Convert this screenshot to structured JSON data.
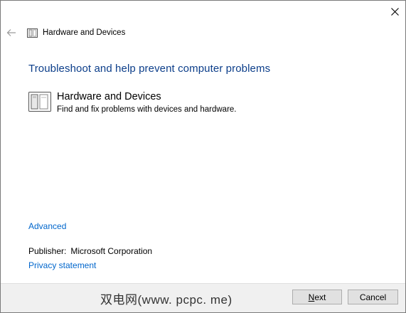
{
  "window": {
    "title": "Hardware and Devices"
  },
  "header": {
    "heading": "Troubleshoot and help prevent computer problems"
  },
  "troubleshooter": {
    "title": "Hardware and Devices",
    "description": "Find and fix problems with devices and hardware."
  },
  "links": {
    "advanced": "Advanced",
    "privacy": "Privacy statement"
  },
  "publisher": {
    "label": "Publisher:",
    "value": "Microsoft Corporation"
  },
  "footer": {
    "watermark": "双电网(www. pcpc. me)",
    "next_mnemonic": "N",
    "next_rest": "ext",
    "cancel": "Cancel"
  },
  "colors": {
    "heading": "#0c3e8a",
    "link": "#0066cc",
    "footer_bg": "#f0f0f0"
  },
  "icons": [
    "close-icon",
    "back-arrow-icon",
    "hardware-device-icon"
  ]
}
